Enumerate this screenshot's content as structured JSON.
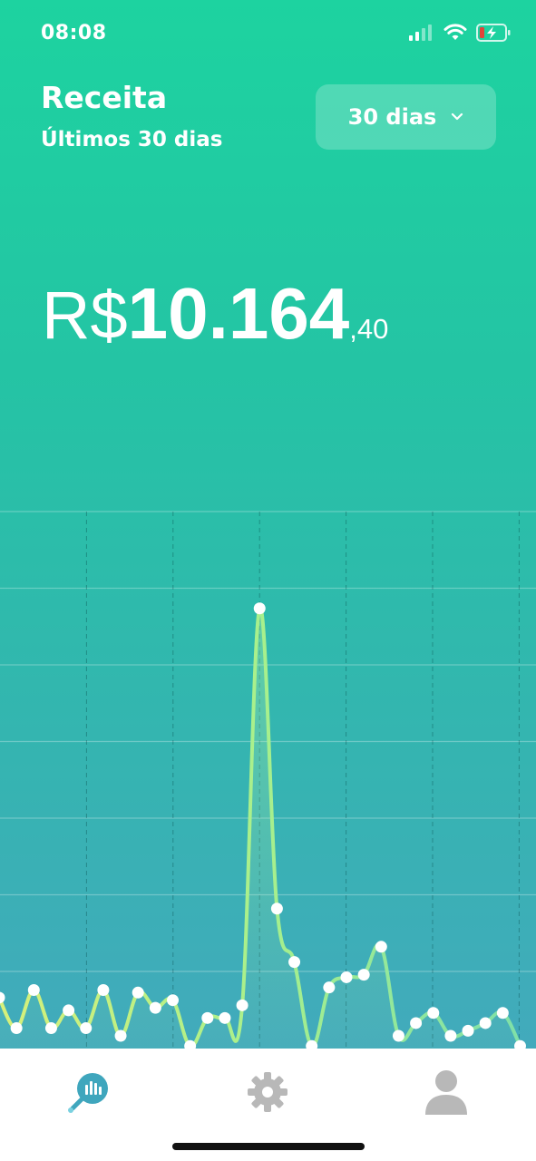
{
  "status_bar": {
    "time": "08:08"
  },
  "header": {
    "title": "Receita",
    "subtitle": "Últimos 30 dias"
  },
  "period_select": {
    "value": "30 dias"
  },
  "total": {
    "currency": "R$",
    "integer": "10.164",
    "decimal": ",40"
  },
  "chart_data": {
    "type": "line",
    "points_count": 31,
    "values": [
      2,
      0.8,
      2.3,
      0.8,
      1.5,
      0.8,
      2.3,
      0.5,
      2.2,
      1.6,
      1.9,
      0.1,
      1.2,
      1.2,
      1.7,
      17.3,
      5.5,
      3.4,
      0.1,
      2.4,
      2.8,
      2.9,
      4.0,
      0.5,
      1.0,
      1.4,
      0.5,
      0.7,
      1.0,
      1.4,
      0.1
    ],
    "ylim": [
      0,
      21
    ],
    "grid": true,
    "line_color": "#a8f08c",
    "marker_color": "#ffffff"
  },
  "tabs": [
    {
      "name": "dashboard",
      "icon": "chart-search-icon",
      "active": true,
      "color": "#3fa6bd"
    },
    {
      "name": "settings",
      "icon": "gear-icon",
      "active": false,
      "color": "#b8b8b8"
    },
    {
      "name": "profile",
      "icon": "user-icon",
      "active": false,
      "color": "#b8b8b8"
    }
  ]
}
